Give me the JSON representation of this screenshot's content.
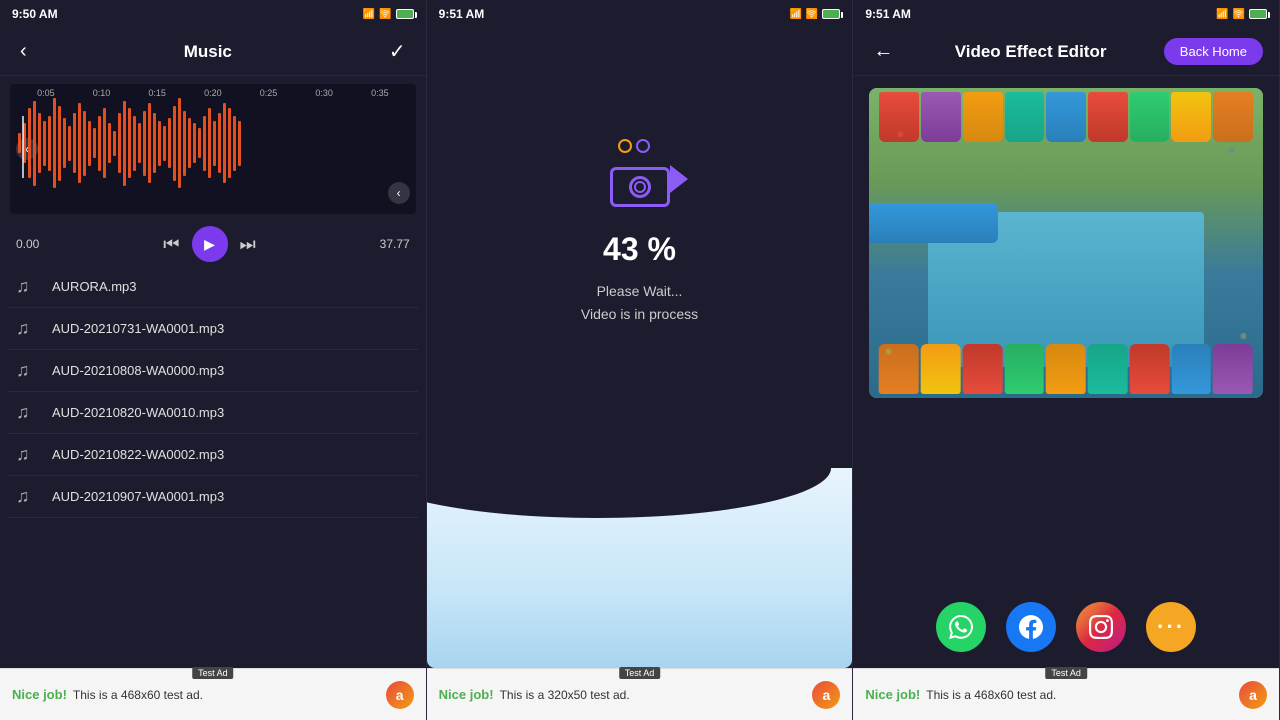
{
  "panel1": {
    "status_time": "9:50 AM",
    "header_title": "Music",
    "waveform_times": [
      "0:05",
      "0:10",
      "0:15",
      "0:20",
      "0:25",
      "0:30",
      "0:35"
    ],
    "player_start": "0.00",
    "player_end": "37.77",
    "music_files": [
      "AURORA.mp3",
      "AUD-20210731-WA0001.mp3",
      "AUD-20210808-WA0000.mp3",
      "AUD-20210820-WA0010.mp3",
      "AUD-20210822-WA0002.mp3",
      "AUD-20210907-WA0001.mp3"
    ],
    "ad_nice": "Nice job!",
    "ad_text": "This is a 468x60 test ad.",
    "ad_label": "Test Ad"
  },
  "panel2": {
    "status_time": "9:51 AM",
    "progress_pct": "43 %",
    "progress_msg_1": "Please Wait...",
    "progress_msg_2": "Video is in process",
    "ad_nice": "Nice job!",
    "ad_text": "This is a 320x50 test ad.",
    "ad_label": "Test Ad"
  },
  "panel3": {
    "status_time": "9:51 AM",
    "header_title": "Video Effect Editor",
    "back_home_label": "Back Home",
    "share_buttons": [
      "WhatsApp",
      "Facebook",
      "Instagram",
      "More"
    ],
    "ad_nice": "Nice job!",
    "ad_text": "This is a 468x60 test ad.",
    "ad_label": "Test Ad"
  }
}
